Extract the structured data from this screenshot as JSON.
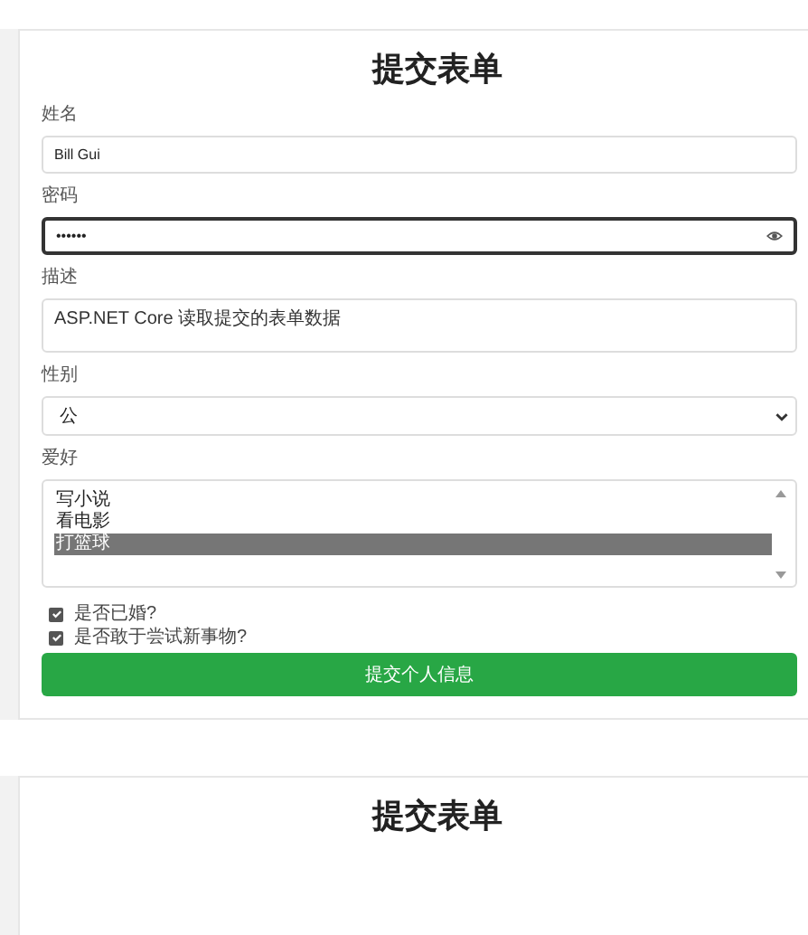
{
  "forms": [
    {
      "title": "提交表单",
      "fields": [
        {
          "kind": "text",
          "label": "姓名",
          "value": "Bill Gui"
        },
        {
          "kind": "password",
          "label": "密码",
          "value": "••••••",
          "focused": true
        },
        {
          "kind": "textarea",
          "label": "描述",
          "value": "ASP.NET Core 读取提交的表单数据"
        },
        {
          "kind": "select",
          "label": "性别",
          "value": "公"
        },
        {
          "kind": "listbox",
          "label": "爱好",
          "options": [
            {
              "label": "写小说",
              "selected": false
            },
            {
              "label": "看电影",
              "selected": false
            },
            {
              "label": "打篮球",
              "selected": true
            }
          ]
        }
      ],
      "checkboxes": [
        {
          "label": "是否已婚?",
          "checked": true
        },
        {
          "label": "是否敢于尝试新事物?",
          "checked": true
        }
      ],
      "submit": "提交个人信息"
    },
    {
      "title": "提交表单"
    }
  ]
}
